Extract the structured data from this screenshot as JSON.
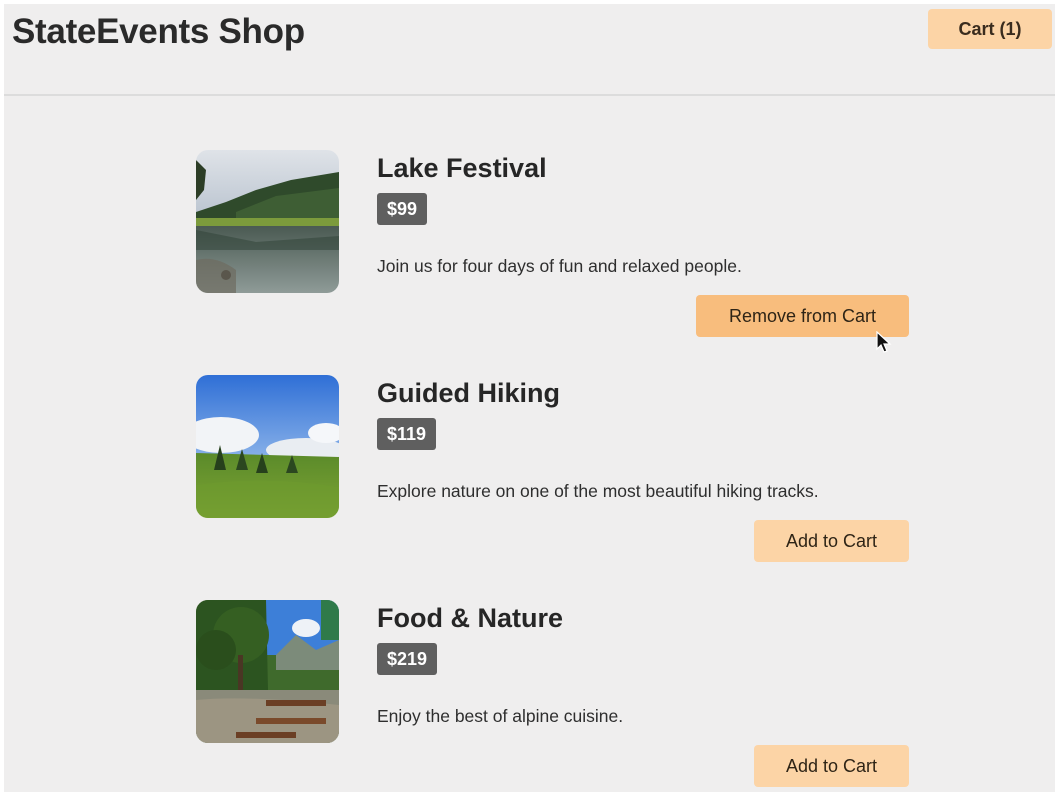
{
  "header": {
    "title": "StateEvents Shop",
    "cart_label": "Cart (1)"
  },
  "products": [
    {
      "name": "Lake Festival",
      "price": "$99",
      "description": "Join us for four days of fun and relaxed people.",
      "action_label": "Remove from Cart",
      "in_cart": true
    },
    {
      "name": "Guided Hiking",
      "price": "$119",
      "description": "Explore nature on one of the most beautiful hiking tracks.",
      "action_label": "Add to Cart",
      "in_cart": false
    },
    {
      "name": "Food & Nature",
      "price": "$219",
      "description": "Enjoy the best of alpine cuisine.",
      "action_label": "Add to Cart",
      "in_cart": false
    }
  ],
  "colors": {
    "background": "#efeeee",
    "cart_button": "#fcd4a6",
    "remove_button": "#f8bd7d",
    "add_button": "#fcd4a6",
    "price_badge": "#5f5f5f"
  }
}
